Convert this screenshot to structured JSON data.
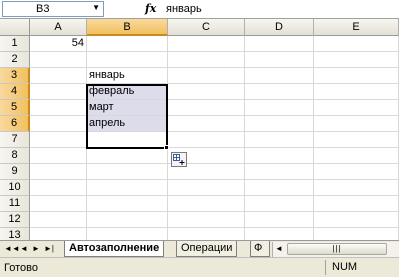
{
  "formula_bar": {
    "name_box": "B3",
    "fx_label": "fx",
    "value": "январь"
  },
  "columns": [
    "A",
    "B",
    "C",
    "D",
    "E"
  ],
  "rows": [
    "1",
    "2",
    "3",
    "4",
    "5",
    "6",
    "7",
    "8",
    "9",
    "10",
    "11",
    "12",
    "13"
  ],
  "cells": {
    "A1": "54",
    "B3": "январь",
    "B4": "февраль",
    "B5": "март",
    "B6": "апрель"
  },
  "selection": {
    "range": "B3:B6",
    "active_cell": "B3"
  },
  "sheet_tabs": {
    "nav": [
      "◄◄",
      "◄",
      "►",
      "►|"
    ],
    "tabs": [
      "Автозаполнение",
      "Операции",
      "Ф"
    ],
    "active": "Автозаполнение"
  },
  "status_bar": {
    "text": "Готово",
    "num": "NUM"
  },
  "colors": {
    "selection_fill": "#dcdcea",
    "header_active": "#f1c15f",
    "border": "#000000"
  }
}
